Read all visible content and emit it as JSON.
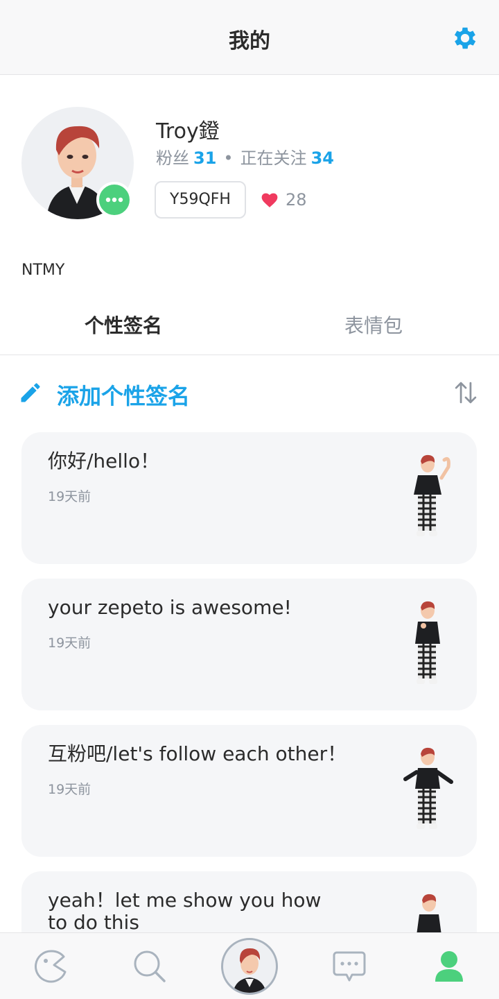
{
  "header": {
    "title": "我的",
    "settings_icon": "gear-icon"
  },
  "profile": {
    "username": "Troy鐙",
    "followers_label": "粉丝",
    "followers_count": "31",
    "separator": "•",
    "following_label": "正在关注",
    "following_count": "34",
    "code": "Y59QFH",
    "likes": "28",
    "bio": "NTMY"
  },
  "tabs": [
    {
      "label": "个性签名",
      "active": true
    },
    {
      "label": "表情包",
      "active": false
    }
  ],
  "add_signature": {
    "label": "添加个性签名"
  },
  "cards": [
    {
      "text": "你好/hello！",
      "time": "19天前"
    },
    {
      "text": "your zepeto is awesome!",
      "time": "19天前"
    },
    {
      "text": "互粉吧/let's follow each other！",
      "time": "19天前"
    },
    {
      "text": "yeah！let me show you how to do this",
      "time": ""
    }
  ],
  "nav": [
    "home-icon",
    "search-icon",
    "profile-avatar",
    "chat-icon",
    "person-icon"
  ],
  "colors": {
    "accent": "#1aa3e8",
    "online": "#4cd07d",
    "heart": "#f03a5f"
  }
}
